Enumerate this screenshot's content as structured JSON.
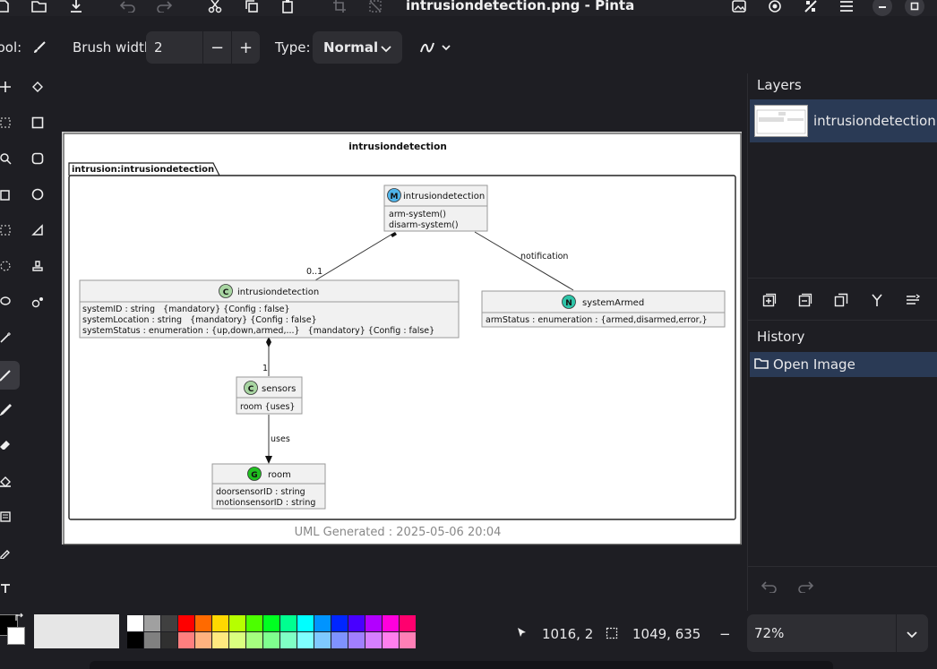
{
  "window": {
    "title": "intrusiondetection.png - Pinta"
  },
  "toolbar": {
    "tool_label": "Tool:",
    "brush_width_label": "Brush width:",
    "brush_width_value": "2",
    "minus": "−",
    "plus": "+",
    "type_label": "Type:",
    "type_value": "Normal"
  },
  "diagram": {
    "title": "intrusiondetection",
    "package": "intrusion:intrusiondetection",
    "footer": "UML Generated : 2025-05-06 20:04",
    "module": {
      "stereotype": "M",
      "name": "intrusiondetection",
      "methods": [
        "arm-system()",
        "disarm-system()"
      ]
    },
    "main_class": {
      "stereotype": "C",
      "name": "intrusiondetection",
      "attributes": [
        "systemID : string   {mandatory} {Config : false}",
        "systemLocation : string   {mandatory} {Config : false}",
        "systemStatus : enumeration : {up,down,armed,...}   {mandatory} {Config : false}"
      ]
    },
    "notification": {
      "stereotype": "N",
      "name": "systemArmed",
      "attributes": [
        "armStatus : enumeration : {armed,disarmed,error,}"
      ]
    },
    "sensors": {
      "stereotype": "C",
      "name": "sensors",
      "attributes": [
        "room {uses}"
      ]
    },
    "room": {
      "stereotype": "G",
      "name": "room",
      "attributes": [
        "doorsensorID : string",
        "motionsensorID : string"
      ]
    },
    "edges": {
      "mult_0_1": "0..1",
      "mult_1": "1",
      "notification_label": "notification",
      "uses_label": "uses"
    },
    "colors": {
      "module_badge": "#4fb3e8",
      "class_badge": "#a8d5a2",
      "notification_badge": "#2ec4a8",
      "grouping_badge": "#20c020"
    }
  },
  "panels": {
    "layers_title": "Layers",
    "layer_name": "intrusiondetection....",
    "history_title": "History",
    "history_item": "Open Image"
  },
  "status": {
    "cursor_pos": "1016, 2",
    "selection_size": "1049, 635",
    "zoom": "72%",
    "zoom_minus": "−"
  },
  "palette": {
    "top": [
      "#ffffff",
      "#a0a0a0",
      "#404040",
      "#ff0000",
      "#ff6a00",
      "#ffd800",
      "#b6ff00",
      "#4cff00",
      "#00ff21",
      "#00ff90",
      "#00ffff",
      "#0094ff",
      "#0026ff",
      "#4800ff",
      "#b200ff",
      "#ff00dc",
      "#ff006e"
    ],
    "bottom": [
      "#000000",
      "#808080",
      "#303030",
      "#ff7f7f",
      "#ffb27f",
      "#ffe97f",
      "#daff7f",
      "#a5ff7f",
      "#7fff8e",
      "#7fffc5",
      "#7fffff",
      "#7fc9ff",
      "#7f92ff",
      "#a17fff",
      "#d67fff",
      "#ff7fed",
      "#ff7fb6"
    ]
  }
}
